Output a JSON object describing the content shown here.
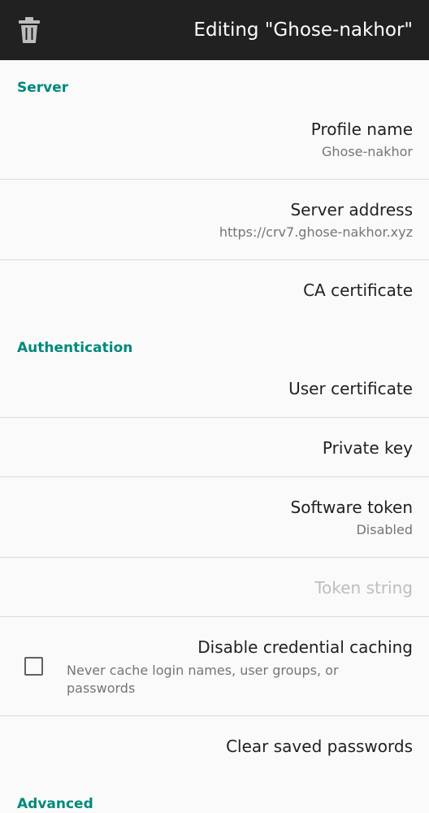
{
  "app_bar": {
    "title": "Editing \"Ghose-nakhor\"",
    "delete_icon": "trash-icon",
    "background": "#212121"
  },
  "accent_color": "#00897b",
  "sections": {
    "server": "Server",
    "authentication": "Authentication",
    "advanced": "Advanced"
  },
  "prefs": {
    "profile_name": {
      "title": "Profile name",
      "summary": "Ghose-nakhor"
    },
    "server_address": {
      "title": "Server address",
      "summary": "https://crv7.ghose-nakhor.xyz"
    },
    "ca_certificate": {
      "title": "CA certificate"
    },
    "user_certificate": {
      "title": "User certificate"
    },
    "private_key": {
      "title": "Private key"
    },
    "software_token": {
      "title": "Software token",
      "summary": "Disabled"
    },
    "token_string": {
      "title": "Token string"
    },
    "disable_credential_caching": {
      "title": "Disable credential caching",
      "summary": "Never cache login names, user groups, or passwords",
      "checked": false
    },
    "clear_saved_passwords": {
      "title": "Clear saved passwords"
    }
  }
}
